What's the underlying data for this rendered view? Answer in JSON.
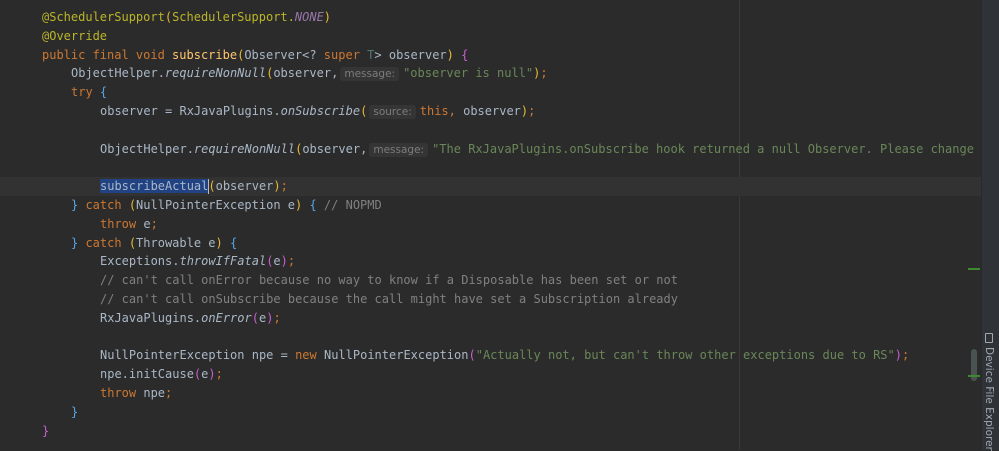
{
  "code": {
    "lines": [
      {
        "indent": 0,
        "tokens": [
          {
            "t": "@SchedulerSupport",
            "c": "ann"
          },
          {
            "t": "(",
            "c": "by"
          },
          {
            "t": "SchedulerSupport.",
            "c": "ann"
          },
          {
            "t": "NONE",
            "c": "const"
          },
          {
            "t": ")",
            "c": "by"
          }
        ]
      },
      {
        "indent": 0,
        "tokens": [
          {
            "t": "@Override",
            "c": "ann"
          }
        ]
      },
      {
        "indent": 0,
        "tokens": [
          {
            "t": "public final void ",
            "c": "kw"
          },
          {
            "t": "subscribe",
            "c": "mdecl"
          },
          {
            "t": "(",
            "c": "by"
          },
          {
            "t": "Observer<? ",
            "c": "def"
          },
          {
            "t": "super ",
            "c": "kw"
          },
          {
            "t": "T",
            "c": "tp"
          },
          {
            "t": "> observer",
            "c": "def"
          },
          {
            "t": ")",
            "c": "by"
          },
          {
            "t": " ",
            "c": "def"
          },
          {
            "t": "{",
            "c": "bp"
          }
        ]
      },
      {
        "indent": 1,
        "tokens": [
          {
            "t": "ObjectHelper.",
            "c": "def"
          },
          {
            "t": "requireNonNull",
            "c": "ital"
          },
          {
            "t": "(",
            "c": "by"
          },
          {
            "t": "observer,",
            "c": "def"
          },
          {
            "t": "message:",
            "c": "hint"
          },
          {
            "t": "\"observer is null\"",
            "c": "str"
          },
          {
            "t": ")",
            "c": "by"
          },
          {
            "t": ";",
            "c": "kw"
          }
        ]
      },
      {
        "indent": 1,
        "tokens": [
          {
            "t": "try ",
            "c": "kw"
          },
          {
            "t": "{",
            "c": "bb"
          }
        ]
      },
      {
        "indent": 2,
        "tokens": [
          {
            "t": "observer = RxJavaPlugins.",
            "c": "def"
          },
          {
            "t": "onSubscribe",
            "c": "ital"
          },
          {
            "t": "(",
            "c": "by"
          },
          {
            "t": "source:",
            "c": "hint"
          },
          {
            "t": "this",
            "c": "kw"
          },
          {
            "t": ", ",
            "c": "kw"
          },
          {
            "t": "observer",
            "c": "def"
          },
          {
            "t": ")",
            "c": "by"
          },
          {
            "t": ";",
            "c": "kw"
          }
        ]
      },
      {
        "indent": 0,
        "tokens": []
      },
      {
        "indent": 2,
        "tokens": [
          {
            "t": "ObjectHelper.",
            "c": "def"
          },
          {
            "t": "requireNonNull",
            "c": "ital"
          },
          {
            "t": "(",
            "c": "by"
          },
          {
            "t": "observer,",
            "c": "def"
          },
          {
            "t": "message:",
            "c": "hint"
          },
          {
            "t": "\"The RxJavaPlugins.onSubscribe hook returned a null Observer. Please change",
            "c": "str"
          }
        ]
      },
      {
        "indent": 0,
        "tokens": []
      },
      {
        "indent": 2,
        "current": true,
        "tokens": [
          {
            "t": "subscribeActual",
            "c": "sel"
          },
          {
            "t": "",
            "c": "caret"
          },
          {
            "t": "(",
            "c": "by"
          },
          {
            "t": "observer",
            "c": "def"
          },
          {
            "t": ")",
            "c": "by"
          },
          {
            "t": ";",
            "c": "kw"
          }
        ]
      },
      {
        "indent": 1,
        "tokens": [
          {
            "t": "}",
            "c": "bb"
          },
          {
            "t": " catch ",
            "c": "kw"
          },
          {
            "t": "(",
            "c": "by"
          },
          {
            "t": "NullPointerException e",
            "c": "def"
          },
          {
            "t": ")",
            "c": "by"
          },
          {
            "t": " ",
            "c": "def"
          },
          {
            "t": "{",
            "c": "bb"
          },
          {
            "t": " // NOPMD",
            "c": "cmt"
          }
        ]
      },
      {
        "indent": 2,
        "tokens": [
          {
            "t": "throw ",
            "c": "kw"
          },
          {
            "t": "e",
            "c": "def"
          },
          {
            "t": ";",
            "c": "kw"
          }
        ]
      },
      {
        "indent": 1,
        "tokens": [
          {
            "t": "}",
            "c": "bb"
          },
          {
            "t": " catch ",
            "c": "kw"
          },
          {
            "t": "(",
            "c": "by"
          },
          {
            "t": "Throwable e",
            "c": "def"
          },
          {
            "t": ")",
            "c": "by"
          },
          {
            "t": " ",
            "c": "def"
          },
          {
            "t": "{",
            "c": "bb"
          }
        ]
      },
      {
        "indent": 2,
        "tokens": [
          {
            "t": "Exceptions.",
            "c": "def"
          },
          {
            "t": "throwIfFatal",
            "c": "ital"
          },
          {
            "t": "(",
            "c": "bp"
          },
          {
            "t": "e",
            "c": "def"
          },
          {
            "t": ")",
            "c": "bp"
          },
          {
            "t": ";",
            "c": "kw"
          }
        ]
      },
      {
        "indent": 2,
        "tokens": [
          {
            "t": "// can't call onError because no way to know if a Disposable has been set or not",
            "c": "cmt"
          }
        ]
      },
      {
        "indent": 2,
        "tokens": [
          {
            "t": "// can't call onSubscribe because the call might have set a Subscription already",
            "c": "cmt"
          }
        ]
      },
      {
        "indent": 2,
        "tokens": [
          {
            "t": "RxJavaPlugins.",
            "c": "def"
          },
          {
            "t": "onError",
            "c": "ital"
          },
          {
            "t": "(",
            "c": "bp"
          },
          {
            "t": "e",
            "c": "def"
          },
          {
            "t": ")",
            "c": "bp"
          },
          {
            "t": ";",
            "c": "kw"
          }
        ]
      },
      {
        "indent": 0,
        "tokens": []
      },
      {
        "indent": 2,
        "tokens": [
          {
            "t": "NullPointerException npe = ",
            "c": "def"
          },
          {
            "t": "new ",
            "c": "kw"
          },
          {
            "t": "NullPointerException",
            "c": "def"
          },
          {
            "t": "(",
            "c": "bp"
          },
          {
            "t": "\"Actually not, but can't throw other exceptions due to RS\"",
            "c": "str"
          },
          {
            "t": ")",
            "c": "bp"
          },
          {
            "t": ";",
            "c": "kw"
          }
        ]
      },
      {
        "indent": 2,
        "tokens": [
          {
            "t": "npe.initCause",
            "c": "def"
          },
          {
            "t": "(",
            "c": "bp"
          },
          {
            "t": "e",
            "c": "def"
          },
          {
            "t": ")",
            "c": "bp"
          },
          {
            "t": ";",
            "c": "kw"
          }
        ]
      },
      {
        "indent": 2,
        "tokens": [
          {
            "t": "throw ",
            "c": "kw"
          },
          {
            "t": "npe",
            "c": "def"
          },
          {
            "t": ";",
            "c": "kw"
          }
        ]
      },
      {
        "indent": 1,
        "tokens": [
          {
            "t": "}",
            "c": "bb"
          }
        ]
      },
      {
        "indent": 0,
        "tokens": [
          {
            "t": "}",
            "c": "bp"
          }
        ]
      }
    ]
  },
  "right_panel": {
    "tool_window_label": "Device File Explorer",
    "icon": "phone-icon"
  },
  "colors": {
    "marker_green": "#3d8a2e",
    "selection": "#214283",
    "background": "#2b2b2b"
  }
}
